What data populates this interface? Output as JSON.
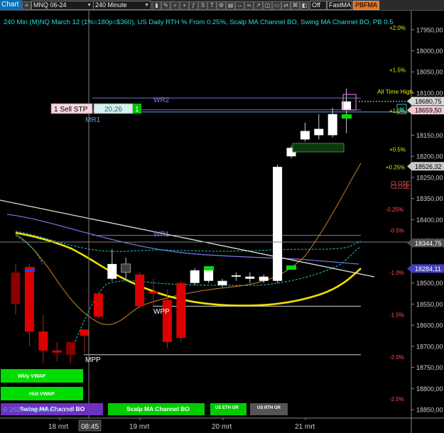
{
  "toolbar": {
    "chart_label": "Chart",
    "instrument": "MNQ 06-24",
    "interval": "240 Minute",
    "toggle_value": "Off",
    "indicator": "FastMA",
    "strategy": "PBFMA"
  },
  "header": {
    "title": "240 Min (M)NQ March 12 (1%=180p=$360), US Daily RTH % From 0.25%, Scalp MA Channel BO, Swing MA Channel BO, PB 0.5"
  },
  "colors": {
    "background": "#000000",
    "bull": "#ffffff",
    "bear": "#dd0000",
    "dark_bear": "#8b0000",
    "neutral_bull": "#404040",
    "signal_green": "#00dd00",
    "vwap_yellow": "#f0e000",
    "channel_cyan": "#20c8c8",
    "trendline": "#e0e0e0",
    "orange_ma": "#d08020",
    "purple_ma": "#7070d8",
    "pct_label_red": "#ff5050",
    "pct_label_yellow": "#e8e800"
  },
  "order": {
    "side_label": "1 Sell STP",
    "price": "20,26",
    "qty": "1"
  },
  "levels": {
    "wr2": "WR2",
    "mr1": "MR1",
    "wr1": "WR1",
    "wpp": "WPP",
    "mpp": "MPP",
    "all_time_high": "All Time High",
    "close1": "CLOSE",
    "close2": "CLOSE"
  },
  "pct_labels": [
    "+2.0%",
    "+1.5%",
    "+1.0%",
    "+0.5%",
    "+0.25%",
    "-0.25%",
    "-0.5%",
    "-1.0%",
    "-1.5%",
    "-2.0%",
    "-2.5%"
  ],
  "price_axis": {
    "ticks": [
      "18850,00",
      "18800,00",
      "18750,00",
      "18700,00",
      "18600,00",
      "18550,00",
      "18500,00",
      "18450,00",
      "18400,00",
      "18350,00",
      "18250,00",
      "18200,00",
      "18150,00",
      "18100,00",
      "18050,00",
      "18000,00",
      "17950,00"
    ],
    "markers": [
      {
        "label": "18680,75",
        "bg": "#d8d8d8",
        "fg": "#000000"
      },
      {
        "label": "18659,50",
        "bg": "#f4c8d0",
        "fg": "#000000"
      },
      {
        "label": "18526,32",
        "bg": "#c8c8c8",
        "fg": "#000000"
      },
      {
        "label": "18344,75",
        "bg": "#505050",
        "fg": "#ffffff"
      },
      {
        "label": "18284,11",
        "bg": "#4040c0",
        "fg": "#ffffff"
      }
    ]
  },
  "time_axis": {
    "labels": [
      "18 mrt",
      "08:45",
      "19 mrt",
      "20 mrt",
      "21 mrt"
    ]
  },
  "signal_buttons": [
    {
      "label": "Wkly VWAP",
      "color": "#00dd00"
    },
    {
      "label": "Hist VWAP",
      "color": "#00dd00"
    },
    {
      "label": "Swing MA Channel BO",
      "color": "#7030c0"
    },
    {
      "label": "Scalp MA Channel BO",
      "color": "#00cc00"
    },
    {
      "label": "US ETH OR",
      "color": "#00cc00"
    },
    {
      "label": "US RTH OR",
      "color": "#555555"
    }
  ],
  "copyright": "© 2024 NinjaTrader, LLC",
  "chart_data": {
    "type": "candlestick",
    "title": "240 Min (M)NQ March 12 (1%=180p=$360), US Daily RTH % From 0.25%, Scalp MA Channel BO, Swing MA Channel BO, PB 0.5",
    "ylim": [
      17930,
      18895
    ],
    "y_ticks": [
      17950,
      18000,
      18050,
      18100,
      18150,
      18200,
      18250,
      18350,
      18400,
      18450,
      18500,
      18550,
      18600,
      18700,
      18750,
      18800,
      18850
    ],
    "x_labels": [
      "18 mrt",
      "19 mrt",
      "20 mrt",
      "21 mrt"
    ],
    "candles": [
      {
        "o": 18275,
        "h": 18295,
        "l": 18175,
        "c": 18200,
        "type": "darkbear"
      },
      {
        "o": 18280,
        "h": 18295,
        "l": 18100,
        "c": 18135,
        "type": "bear"
      },
      {
        "o": 18135,
        "h": 18175,
        "l": 18060,
        "c": 18090,
        "type": "bear"
      },
      {
        "o": 18090,
        "h": 18110,
        "l": 18065,
        "c": 18085,
        "type": "bear"
      },
      {
        "o": 18080,
        "h": 18110,
        "l": 18060,
        "c": 18110,
        "type": "darkbear"
      },
      {
        "o": 18125,
        "h": 18140,
        "l": 18085,
        "c": 18140,
        "type": "bear"
      },
      {
        "o": 18170,
        "h": 18225,
        "l": 18165,
        "c": 18225,
        "type": "bear"
      },
      {
        "o": 18260,
        "h": 18330,
        "l": 18255,
        "c": 18295,
        "type": "bull"
      },
      {
        "o": 18275,
        "h": 18310,
        "l": 18260,
        "c": 18295,
        "type": "neutral"
      },
      {
        "o": 18270,
        "h": 18275,
        "l": 18190,
        "c": 18195,
        "type": "bear"
      },
      {
        "o": 18225,
        "h": 18260,
        "l": 18195,
        "c": 18230,
        "type": "bear"
      },
      {
        "o": 18210,
        "h": 18235,
        "l": 18095,
        "c": 18110,
        "type": "bear"
      },
      {
        "o": 18250,
        "h": 18255,
        "l": 18110,
        "c": 18120,
        "type": "bear"
      },
      {
        "o": 18250,
        "h": 18285,
        "l": 18245,
        "c": 18280,
        "type": "bull"
      },
      {
        "o": 18255,
        "h": 18285,
        "l": 18250,
        "c": 18285,
        "type": "bull"
      },
      {
        "o": 18245,
        "h": 18260,
        "l": 18240,
        "c": 18255,
        "type": "bull"
      },
      {
        "o": 18265,
        "h": 18275,
        "l": 18255,
        "c": 18268,
        "type": "bull"
      },
      {
        "o": 18260,
        "h": 18275,
        "l": 18250,
        "c": 18265,
        "type": "bull"
      },
      {
        "o": 18255,
        "h": 18270,
        "l": 18250,
        "c": 18265,
        "type": "bull"
      },
      {
        "o": 18255,
        "h": 18530,
        "l": 18250,
        "c": 18525,
        "type": "bull"
      },
      {
        "o": 18550,
        "h": 18575,
        "l": 18545,
        "c": 18570,
        "type": "bull"
      },
      {
        "o": 18590,
        "h": 18630,
        "l": 18585,
        "c": 18610,
        "type": "bull"
      },
      {
        "o": 18600,
        "h": 18650,
        "l": 18590,
        "c": 18615,
        "type": "bull"
      },
      {
        "o": 18600,
        "h": 18665,
        "l": 18595,
        "c": 18650,
        "type": "bull"
      },
      {
        "o": 18660,
        "h": 18710,
        "l": 18605,
        "c": 18680,
        "type": "bull"
      }
    ],
    "levels": [
      {
        "name": "WR2",
        "price": 18688
      },
      {
        "name": "MR1",
        "price": 18655
      },
      {
        "name": "WR1",
        "price": 18363
      },
      {
        "name": "WPP",
        "price": 18195
      },
      {
        "name": "MPP",
        "price": 18080
      },
      {
        "name": "All Time High",
        "price": 18680
      }
    ],
    "percent_levels": [
      {
        "label": "+2.0%",
        "price": 18855
      },
      {
        "label": "+1.5%",
        "price": 18755
      },
      {
        "label": "+1.0%",
        "price": 18658
      },
      {
        "label": "+0.5%",
        "price": 18566
      },
      {
        "label": "+0.25%",
        "price": 18524
      },
      {
        "label": "-0.25%",
        "price": 18424
      },
      {
        "label": "-0.5%",
        "price": 18375
      },
      {
        "label": "-1.0%",
        "price": 18275
      },
      {
        "label": "-1.5%",
        "price": 18175
      },
      {
        "label": "-2.0%",
        "price": 18075
      },
      {
        "label": "-2.5%",
        "price": 17975
      }
    ]
  }
}
